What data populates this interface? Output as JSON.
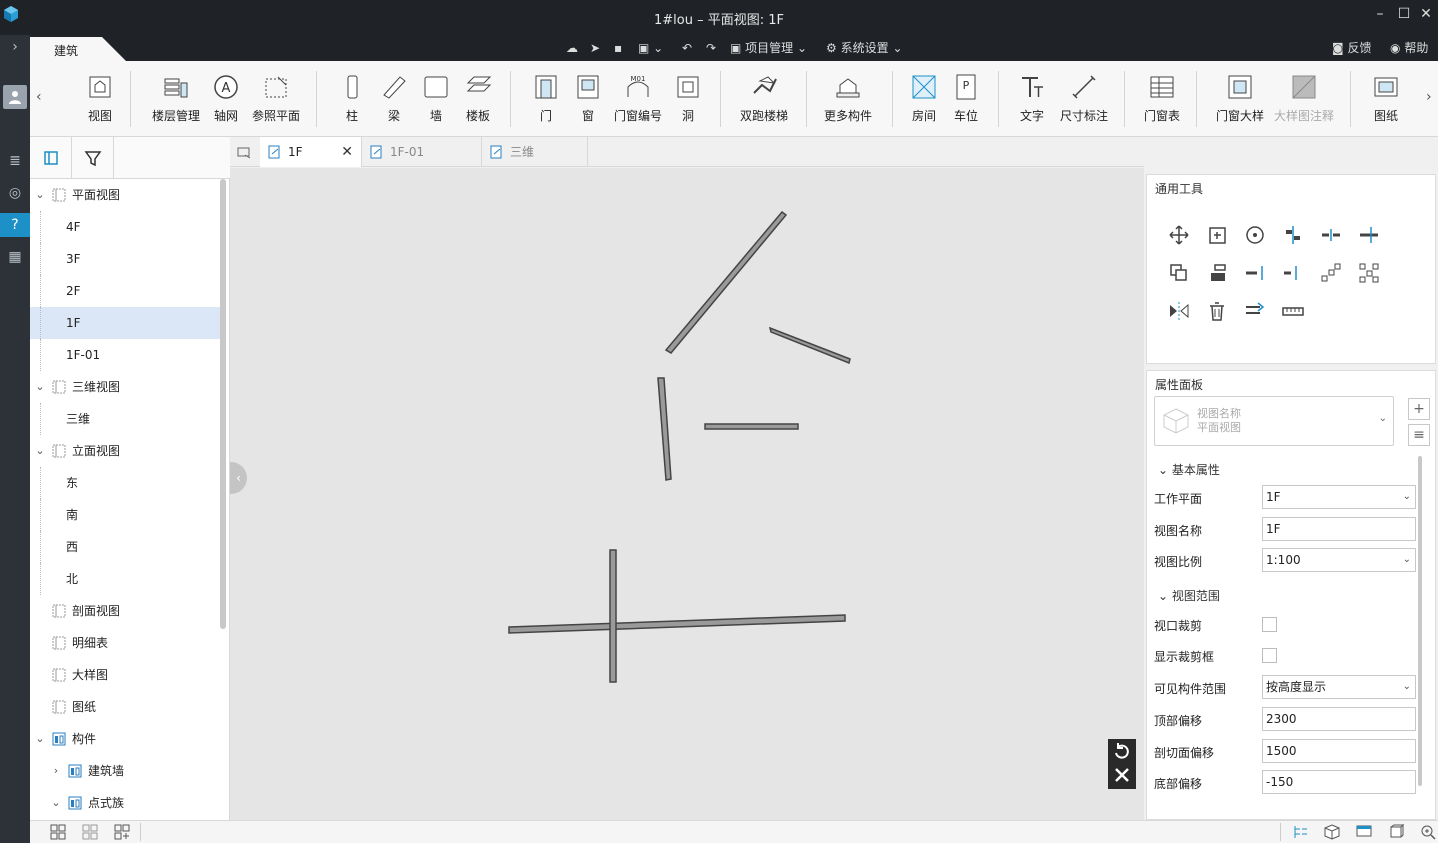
{
  "window": {
    "title": "1#lou – 平面视图: 1F",
    "controls": [
      "minimize",
      "maximize",
      "close"
    ]
  },
  "menubar": {
    "active_tab": "建筑",
    "project_menu": "项目管理",
    "settings_menu": "系统设置",
    "feedback": "反馈",
    "help": "帮助"
  },
  "ribbon": {
    "items": [
      {
        "label": "视图"
      },
      {
        "label": "楼层管理"
      },
      {
        "label": "轴网"
      },
      {
        "label": "参照平面"
      },
      {
        "label": "柱"
      },
      {
        "label": "梁"
      },
      {
        "label": "墙"
      },
      {
        "label": "楼板"
      },
      {
        "label": "门"
      },
      {
        "label": "窗"
      },
      {
        "label": "门窗编号",
        "icon_text": "M01"
      },
      {
        "label": "洞"
      },
      {
        "label": "双跑楼梯"
      },
      {
        "label": "更多构件"
      },
      {
        "label": "房间"
      },
      {
        "label": "车位",
        "icon_text": "P"
      },
      {
        "label": "文字"
      },
      {
        "label": "尺寸标注"
      },
      {
        "label": "门窗表"
      },
      {
        "label": "门窗大样"
      },
      {
        "label": "大样图注释"
      },
      {
        "label": "图纸"
      }
    ]
  },
  "tree": {
    "rows": [
      {
        "label": "平面视图",
        "level": 0,
        "expanded": true
      },
      {
        "label": "4F",
        "level": 1
      },
      {
        "label": "3F",
        "level": 1
      },
      {
        "label": "2F",
        "level": 1
      },
      {
        "label": "1F",
        "level": 1,
        "selected": true
      },
      {
        "label": "1F-01",
        "level": 1
      },
      {
        "label": "三维视图",
        "level": 0,
        "expanded": true
      },
      {
        "label": "三维",
        "level": 1
      },
      {
        "label": "立面视图",
        "level": 0,
        "expanded": true
      },
      {
        "label": "东",
        "level": 1
      },
      {
        "label": "南",
        "level": 1
      },
      {
        "label": "西",
        "level": 1
      },
      {
        "label": "北",
        "level": 1
      },
      {
        "label": "剖面视图",
        "level": 0
      },
      {
        "label": "明细表",
        "level": 0
      },
      {
        "label": "大样图",
        "level": 0
      },
      {
        "label": "图纸",
        "level": 0
      },
      {
        "label": "构件",
        "level": 0,
        "expanded": true
      },
      {
        "label": "建筑墙",
        "level": 1,
        "expanded": false
      },
      {
        "label": "点式族",
        "level": 1,
        "expanded": true
      }
    ]
  },
  "doc_tabs": [
    {
      "label": "1F",
      "active": true
    },
    {
      "label": "1F-01"
    },
    {
      "label": "三维"
    }
  ],
  "tools_panel": {
    "title": "通用工具"
  },
  "properties": {
    "title": "属性面板",
    "view_select": {
      "name_label": "视图名称",
      "type_label": "平面视图"
    },
    "sections": [
      {
        "label": "基本属性"
      },
      {
        "label": "视图范围"
      }
    ],
    "fields": [
      {
        "label": "工作平面",
        "value": "1F",
        "type": "select"
      },
      {
        "label": "视图名称",
        "value": "1F",
        "type": "text"
      },
      {
        "label": "视图比例",
        "value": "1:100",
        "type": "select"
      },
      {
        "label": "视口裁剪",
        "value": "",
        "type": "checkbox"
      },
      {
        "label": "显示裁剪框",
        "value": "",
        "type": "checkbox"
      },
      {
        "label": "可见构件范围",
        "value": "按高度显示",
        "type": "select"
      },
      {
        "label": "顶部偏移",
        "value": "2300",
        "type": "text"
      },
      {
        "label": "剖切面偏移",
        "value": "1500",
        "type": "text"
      },
      {
        "label": "底部偏移",
        "value": "-150",
        "type": "text"
      }
    ]
  },
  "colors": {
    "titlebar": "#1f2328",
    "accent": "#1e90c8",
    "selection": "#dbe7f6",
    "canvas": "#e5e5e5",
    "wall": "#9a9a9a"
  }
}
